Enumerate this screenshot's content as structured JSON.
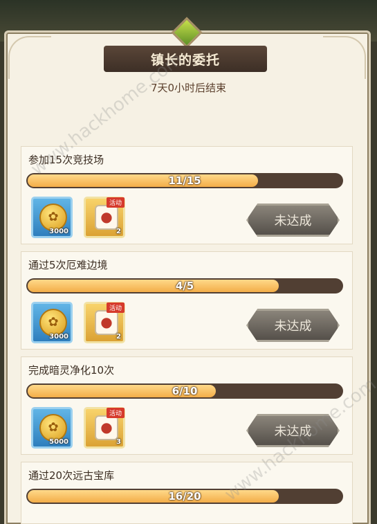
{
  "title": "镇长的委托",
  "timer": "7天0小时后结束",
  "watermark": "www.hackhome.com",
  "tasks": [
    {
      "name": "参加15次竞技场",
      "progress_text": "11/15",
      "progress": 0.733,
      "coin_qty": "3000",
      "dice_qty": "2",
      "dice_tag": "活动",
      "button": "未达成"
    },
    {
      "name": "通过5次厄难边境",
      "progress_text": "4/5",
      "progress": 0.8,
      "coin_qty": "3000",
      "dice_qty": "2",
      "dice_tag": "活动",
      "button": "未达成"
    },
    {
      "name": "完成暗灵净化10次",
      "progress_text": "6/10",
      "progress": 0.6,
      "coin_qty": "5000",
      "dice_qty": "3",
      "dice_tag": "活动",
      "button": "未达成"
    },
    {
      "name": "通过20次远古宝库",
      "progress_text": "16/20",
      "progress": 0.8
    }
  ]
}
